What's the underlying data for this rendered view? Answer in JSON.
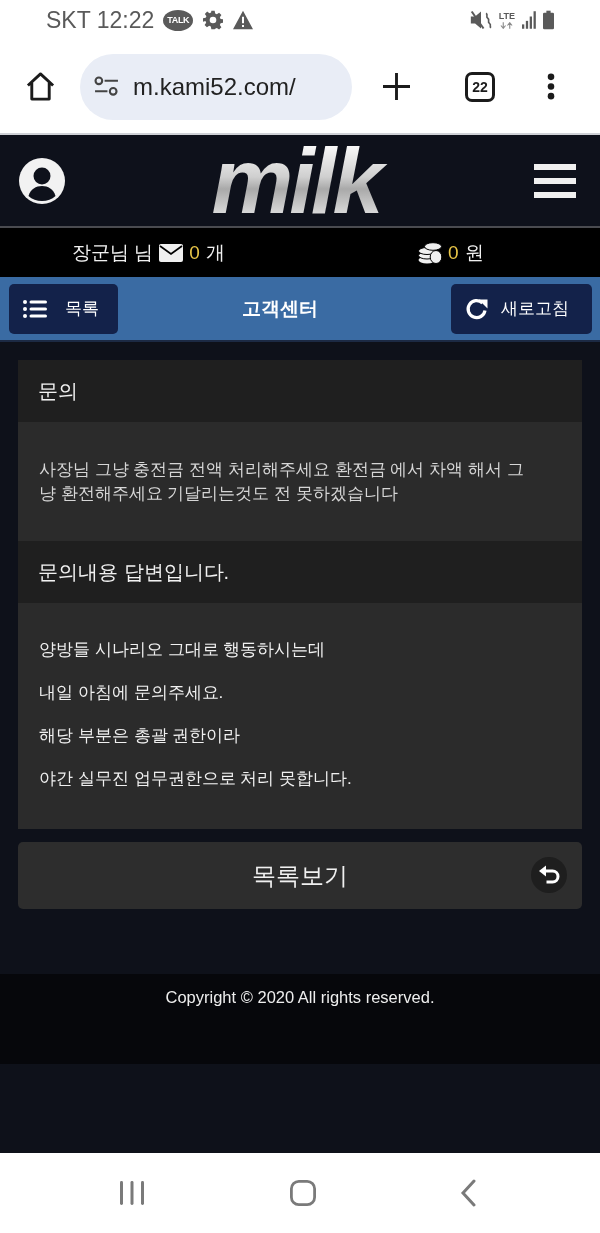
{
  "status_bar": {
    "carrier_time": "SKT 12:22",
    "chat_badge": "TALK",
    "network": "LTE"
  },
  "browser": {
    "url": "m.kami52.com/",
    "tab_count": "22"
  },
  "header": {
    "logo": "milk"
  },
  "account": {
    "username": "장군님 님",
    "messages": "0",
    "messages_unit": "개",
    "balance": "0",
    "balance_unit": "원"
  },
  "toolbar": {
    "list_button": "목록",
    "title": "고객센터",
    "refresh_button": "새로고침"
  },
  "inquiry": {
    "title": "문의",
    "text": "사장님 그냥 충전금 전액 처리해주세요 환전금 에서 차액 해서 그냥 환전해주세요 기달리는것도 전 못하겠습니다"
  },
  "answer": {
    "title": "문의내용 답변입니다.",
    "lines": [
      "양방들 시나리오 그대로 행동하시는데",
      "내일 아침에 문의주세요.",
      "해당 부분은 총괄 권한이라",
      "야간 실무진 업무권한으로 처리 못합니다."
    ]
  },
  "back_to_list_button": "목록보기",
  "footer": {
    "copyright": "Copyright © 2020 All rights reserved."
  }
}
